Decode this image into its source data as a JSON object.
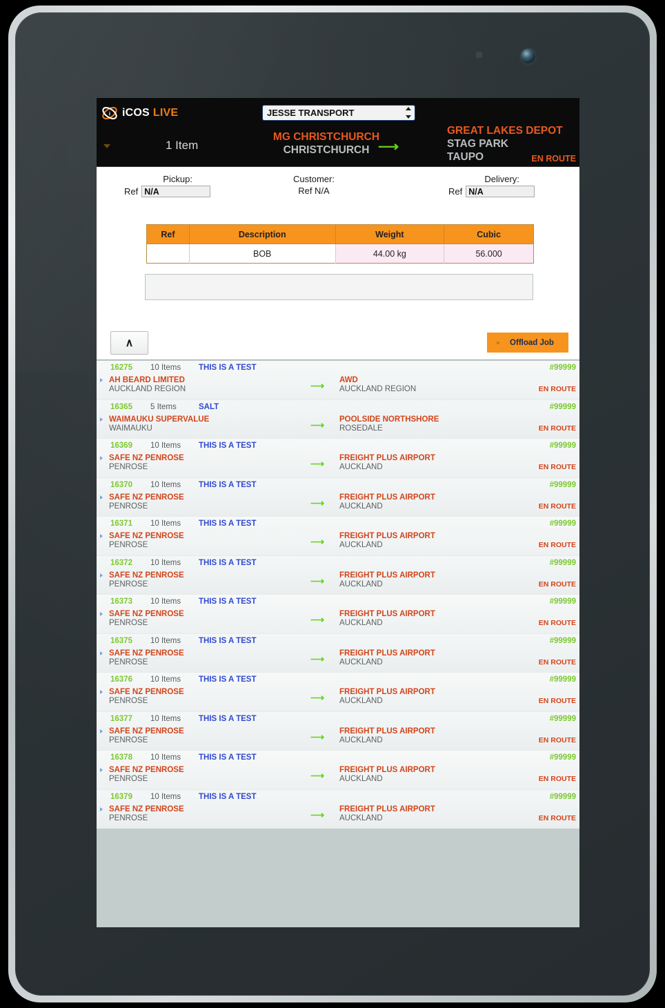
{
  "device": {
    "sensor_icon": "proximity-sensor",
    "camera_icon": "front-camera-lens"
  },
  "header": {
    "logo_icon": "icos-swirl-logo",
    "logo_primary": "iCOS",
    "logo_accent": "LIVE",
    "company_selected": "JESSE TRANSPORT",
    "company_options": [
      "JESSE TRANSPORT"
    ],
    "expand_caret_icon": "chevron-down-icon",
    "item_count": "1 Item",
    "origin_name": "MG CHRISTCHURCH",
    "origin_place": "CHRISTCHURCH",
    "route_arrow_icon": "arrow-right-icon",
    "dest_name": "GREAT LAKES DEPOT",
    "dest_place": "STAG PARK",
    "dest_city": "TAUPO",
    "status": "EN ROUTE",
    "colors": {
      "accent_orange": "#e8591d",
      "brand_orange": "#f07d10",
      "muted_grey": "#b9bdbd",
      "arrow_green": "#62d41a",
      "header_bg": "#0b0b0c"
    }
  },
  "detail": {
    "pickup_caption": "Pickup:",
    "pickup_ref_label": "Ref",
    "pickup_ref_value": "N/A",
    "pickup_ref_placeholder": "N/A",
    "customer_caption": "Customer:",
    "customer_ref_text": "Ref N/A",
    "delivery_caption": "Delivery:",
    "delivery_ref_label": "Ref",
    "delivery_ref_value": "N/A",
    "delivery_ref_placeholder": "N/A",
    "notes_value": "",
    "notes_placeholder": "",
    "table": {
      "columns": [
        "Ref",
        "Description",
        "Weight",
        "Cubic"
      ],
      "rows": [
        {
          "ref": "",
          "description": "BOB",
          "weight": "44.00 kg",
          "cubic": "56.000"
        }
      ],
      "header_bg": "#f7941e",
      "numeric_cell_bg": "#fbeaf4"
    }
  },
  "actions": {
    "collapse_label": "∧",
    "collapse_icon": "chevron-up-icon",
    "offload_label": "Offload Job",
    "offload_bg": "#f7941e",
    "offload_text_color": "#1c2b52"
  },
  "job_list": {
    "arrow_icon": "arrow-right-icon",
    "marker_icon": "chevron-right-marker-icon",
    "rows": [
      {
        "id": "16275",
        "items": "10 Items",
        "note": "THIS IS A TEST",
        "code": "#99999",
        "from_name": "AH BEARD LIMITED",
        "from_place": "AUCKLAND REGION",
        "to_name": "AWD",
        "to_place": "AUCKLAND REGION",
        "status": "EN ROUTE"
      },
      {
        "id": "16365",
        "items": "5 Items",
        "note": "SALT",
        "code": "#99999",
        "from_name": "WAIMAUKU SUPERVALUE",
        "from_place": "WAIMAUKU",
        "to_name": "POOLSIDE NORTHSHORE",
        "to_place": "ROSEDALE",
        "status": "EN ROUTE"
      },
      {
        "id": "16369",
        "items": "10 Items",
        "note": "THIS IS A TEST",
        "code": "#99999",
        "from_name": "SAFE NZ PENROSE",
        "from_place": "PENROSE",
        "to_name": "FREIGHT PLUS AIRPORT",
        "to_place": "AUCKLAND",
        "status": "EN ROUTE"
      },
      {
        "id": "16370",
        "items": "10 Items",
        "note": "THIS IS A TEST",
        "code": "#99999",
        "from_name": "SAFE NZ PENROSE",
        "from_place": "PENROSE",
        "to_name": "FREIGHT PLUS AIRPORT",
        "to_place": "AUCKLAND",
        "status": "EN ROUTE"
      },
      {
        "id": "16371",
        "items": "10 Items",
        "note": "THIS IS A TEST",
        "code": "#99999",
        "from_name": "SAFE NZ PENROSE",
        "from_place": "PENROSE",
        "to_name": "FREIGHT PLUS AIRPORT",
        "to_place": "AUCKLAND",
        "status": "EN ROUTE"
      },
      {
        "id": "16372",
        "items": "10 Items",
        "note": "THIS IS A TEST",
        "code": "#99999",
        "from_name": "SAFE NZ PENROSE",
        "from_place": "PENROSE",
        "to_name": "FREIGHT PLUS AIRPORT",
        "to_place": "AUCKLAND",
        "status": "EN ROUTE"
      },
      {
        "id": "16373",
        "items": "10 Items",
        "note": "THIS IS A TEST",
        "code": "#99999",
        "from_name": "SAFE NZ PENROSE",
        "from_place": "PENROSE",
        "to_name": "FREIGHT PLUS AIRPORT",
        "to_place": "AUCKLAND",
        "status": "EN ROUTE"
      },
      {
        "id": "16375",
        "items": "10 Items",
        "note": "THIS IS A TEST",
        "code": "#99999",
        "from_name": "SAFE NZ PENROSE",
        "from_place": "PENROSE",
        "to_name": "FREIGHT PLUS AIRPORT",
        "to_place": "AUCKLAND",
        "status": "EN ROUTE"
      },
      {
        "id": "16376",
        "items": "10 Items",
        "note": "THIS IS A TEST",
        "code": "#99999",
        "from_name": "SAFE NZ PENROSE",
        "from_place": "PENROSE",
        "to_name": "FREIGHT PLUS AIRPORT",
        "to_place": "AUCKLAND",
        "status": "EN ROUTE"
      },
      {
        "id": "16377",
        "items": "10 Items",
        "note": "THIS IS A TEST",
        "code": "#99999",
        "from_name": "SAFE NZ PENROSE",
        "from_place": "PENROSE",
        "to_name": "FREIGHT PLUS AIRPORT",
        "to_place": "AUCKLAND",
        "status": "EN ROUTE"
      },
      {
        "id": "16378",
        "items": "10 Items",
        "note": "THIS IS A TEST",
        "code": "#99999",
        "from_name": "SAFE NZ PENROSE",
        "from_place": "PENROSE",
        "to_name": "FREIGHT PLUS AIRPORT",
        "to_place": "AUCKLAND",
        "status": "EN ROUTE"
      },
      {
        "id": "16379",
        "items": "10 Items",
        "note": "THIS IS A TEST",
        "code": "#99999",
        "from_name": "SAFE NZ PENROSE",
        "from_place": "PENROSE",
        "to_name": "FREIGHT PLUS AIRPORT",
        "to_place": "AUCKLAND",
        "status": "EN ROUTE"
      }
    ]
  }
}
